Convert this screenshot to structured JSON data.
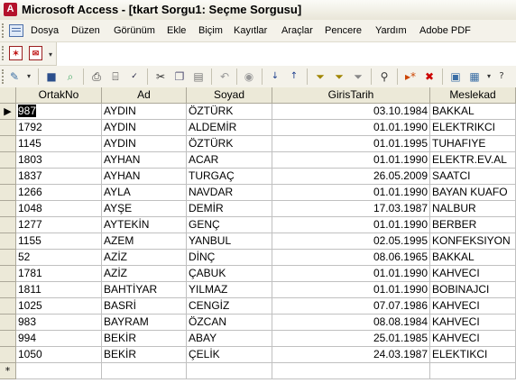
{
  "window": {
    "title": "Microsoft Access - [tkart Sorgu1: Seçme Sorgusu]",
    "app_icon": "A"
  },
  "menu": {
    "items": [
      "Dosya",
      "Düzen",
      "Görünüm",
      "Ekle",
      "Biçim",
      "Kayıtlar",
      "Araçlar",
      "Pencere",
      "Yardım",
      "Adobe PDF"
    ]
  },
  "pdf_toolbar": {
    "icons": [
      "pdf-convert-icon",
      "pdf-email-icon"
    ]
  },
  "toolbar": {
    "icons": [
      "view-design-icon",
      "save-icon",
      "search-db-icon",
      "print-icon",
      "print-preview-icon",
      "spelling-icon",
      "cut-icon",
      "copy-icon",
      "paste-icon",
      "undo-icon",
      "hyperlink-icon",
      "sort-ascending-icon",
      "sort-descending-icon",
      "filter-by-selection-icon",
      "filter-by-form-icon",
      "apply-filter-icon",
      "find-icon",
      "new-record-icon",
      "delete-record-icon",
      "database-window-icon",
      "new-object-icon"
    ]
  },
  "grid": {
    "columns": [
      "OrtakNo",
      "Ad",
      "Soyad",
      "GirisTarih",
      "Meslekad"
    ],
    "current_row_marker": "▶",
    "new_row_marker": "*",
    "rows": [
      [
        "987",
        "AYDIN",
        "ÖZTÜRK",
        "03.10.1984",
        "BAKKAL"
      ],
      [
        "1792",
        "AYDIN",
        "ALDEMİR",
        "01.01.1990",
        "ELEKTRIKCI"
      ],
      [
        "1145",
        "AYDIN",
        "ÖZTÜRK",
        "01.01.1995",
        "TUHAFIYE"
      ],
      [
        "1803",
        "AYHAN",
        "ACAR",
        "01.01.1990",
        "ELEKTR.EV.AL"
      ],
      [
        "1837",
        "AYHAN",
        "TURGAÇ",
        "26.05.2009",
        "SAATCI"
      ],
      [
        "1266",
        "AYLA",
        "NAVDAR",
        "01.01.1990",
        "BAYAN KUAFO"
      ],
      [
        "1048",
        "AYŞE",
        "DEMİR",
        "17.03.1987",
        "NALBUR"
      ],
      [
        "1277",
        "AYTEKİN",
        "GENÇ",
        "01.01.1990",
        "BERBER"
      ],
      [
        "1155",
        "AZEM",
        "YANBUL",
        "02.05.1995",
        "KONFEKSIYON"
      ],
      [
        "52",
        "AZİZ",
        "DİNÇ",
        "08.06.1965",
        "BAKKAL"
      ],
      [
        "1781",
        "AZİZ",
        "ÇABUK",
        "01.01.1990",
        "KAHVECI"
      ],
      [
        "1811",
        "BAHTİYAR",
        "YILMAZ",
        "01.01.1990",
        "BOBINAJCI"
      ],
      [
        "1025",
        "BASRİ",
        "CENGİZ",
        "07.07.1986",
        "KAHVECI"
      ],
      [
        "983",
        "BAYRAM",
        "ÖZCAN",
        "08.08.1984",
        "KAHVECI"
      ],
      [
        "994",
        "BEKİR",
        "ABAY",
        "25.01.1985",
        "KAHVECI"
      ],
      [
        "1050",
        "BEKİR",
        "ÇELİK",
        "24.03.1987",
        "ELEKTIKCI"
      ]
    ]
  }
}
